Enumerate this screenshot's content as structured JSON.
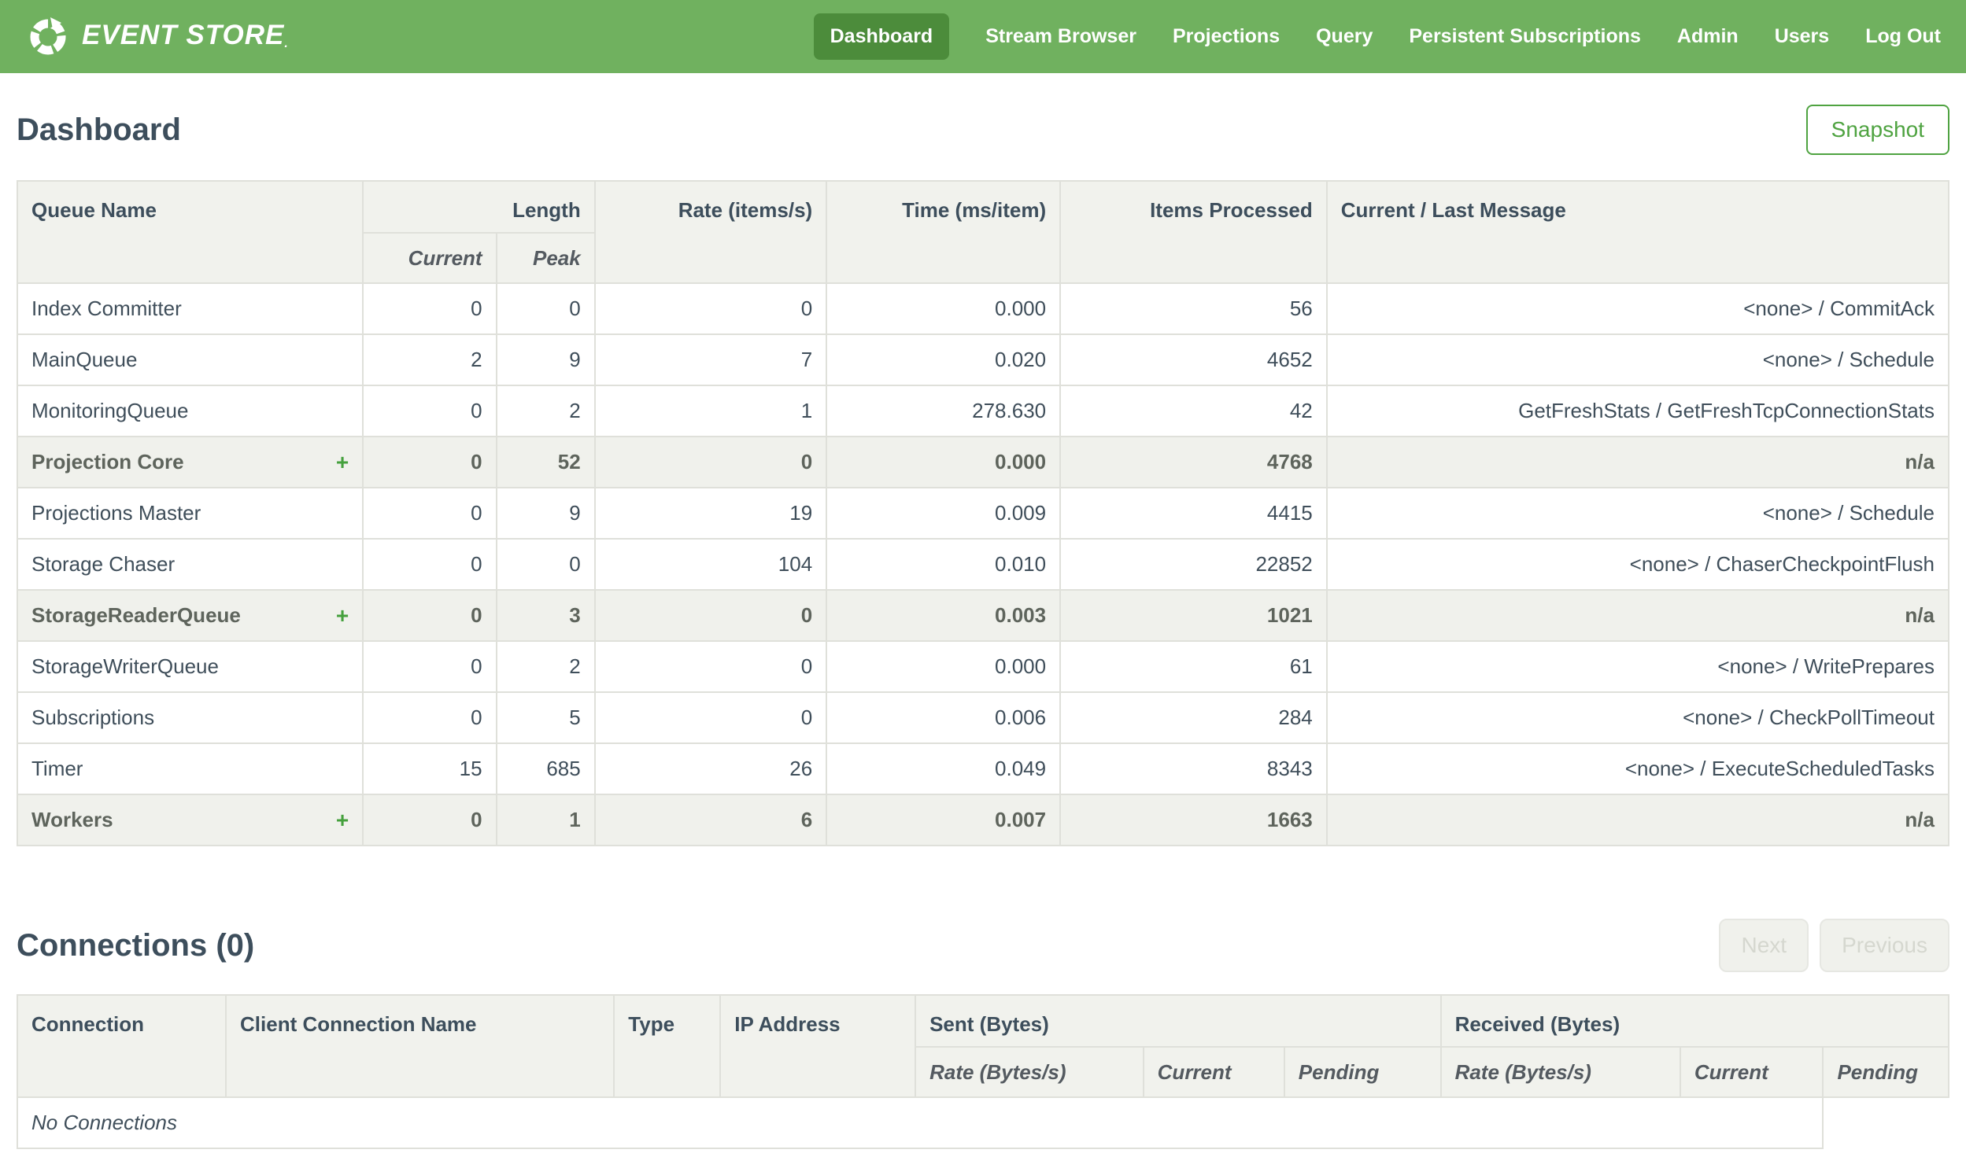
{
  "nav": {
    "brand": "EVENT STORE",
    "brand_mark": ".",
    "items": [
      {
        "label": "Dashboard",
        "active": true
      },
      {
        "label": "Stream Browser",
        "active": false
      },
      {
        "label": "Projections",
        "active": false
      },
      {
        "label": "Query",
        "active": false
      },
      {
        "label": "Persistent Subscriptions",
        "active": false
      },
      {
        "label": "Admin",
        "active": false
      },
      {
        "label": "Users",
        "active": false
      },
      {
        "label": "Log Out",
        "active": false
      }
    ]
  },
  "page": {
    "title": "Dashboard",
    "snapshot_button": "Snapshot"
  },
  "queue_table": {
    "expand_symbol": "+",
    "headers": {
      "queue_name": "Queue Name",
      "length": "Length",
      "current": "Current",
      "peak": "Peak",
      "rate": "Rate (items/s)",
      "time": "Time (ms/item)",
      "items_processed": "Items Processed",
      "message": "Current / Last Message"
    },
    "rows": [
      {
        "name": "Index Committer",
        "group": false,
        "current": "0",
        "peak": "0",
        "rate": "0",
        "time": "0.000",
        "items": "56",
        "message": "<none> / CommitAck"
      },
      {
        "name": "MainQueue",
        "group": false,
        "current": "2",
        "peak": "9",
        "rate": "7",
        "time": "0.020",
        "items": "4652",
        "message": "<none> / Schedule"
      },
      {
        "name": "MonitoringQueue",
        "group": false,
        "current": "0",
        "peak": "2",
        "rate": "1",
        "time": "278.630",
        "items": "42",
        "message": "GetFreshStats / GetFreshTcpConnectionStats"
      },
      {
        "name": "Projection Core",
        "group": true,
        "current": "0",
        "peak": "52",
        "rate": "0",
        "time": "0.000",
        "items": "4768",
        "message": "n/a"
      },
      {
        "name": "Projections Master",
        "group": false,
        "current": "0",
        "peak": "9",
        "rate": "19",
        "time": "0.009",
        "items": "4415",
        "message": "<none> / Schedule"
      },
      {
        "name": "Storage Chaser",
        "group": false,
        "current": "0",
        "peak": "0",
        "rate": "104",
        "time": "0.010",
        "items": "22852",
        "message": "<none> / ChaserCheckpointFlush"
      },
      {
        "name": "StorageReaderQueue",
        "group": true,
        "current": "0",
        "peak": "3",
        "rate": "0",
        "time": "0.003",
        "items": "1021",
        "message": "n/a"
      },
      {
        "name": "StorageWriterQueue",
        "group": false,
        "current": "0",
        "peak": "2",
        "rate": "0",
        "time": "0.000",
        "items": "61",
        "message": "<none> / WritePrepares"
      },
      {
        "name": "Subscriptions",
        "group": false,
        "current": "0",
        "peak": "5",
        "rate": "0",
        "time": "0.006",
        "items": "284",
        "message": "<none> / CheckPollTimeout"
      },
      {
        "name": "Timer",
        "group": false,
        "current": "15",
        "peak": "685",
        "rate": "26",
        "time": "0.049",
        "items": "8343",
        "message": "<none> / ExecuteScheduledTasks"
      },
      {
        "name": "Workers",
        "group": true,
        "current": "0",
        "peak": "1",
        "rate": "6",
        "time": "0.007",
        "items": "1663",
        "message": "n/a"
      }
    ]
  },
  "connections": {
    "title": "Connections (0)",
    "next_button": "Next",
    "previous_button": "Previous",
    "headers": {
      "connection": "Connection",
      "client_connection_name": "Client Connection Name",
      "type": "Type",
      "ip_address": "IP Address",
      "sent": "Sent (Bytes)",
      "received": "Received (Bytes)",
      "rate": "Rate (Bytes/s)",
      "current": "Current",
      "pending": "Pending"
    },
    "empty_message": "No Connections"
  },
  "colors": {
    "nav_green": "#70B15F",
    "nav_active_green": "#4C8C3B",
    "accent_green": "#4FA341",
    "plus_green": "#44A03C",
    "heading_text": "#3D4E5C",
    "table_header_bg": "#F1F2ED",
    "table_border": "#DFE0DA",
    "group_row_bg": "#F0F1EC"
  }
}
